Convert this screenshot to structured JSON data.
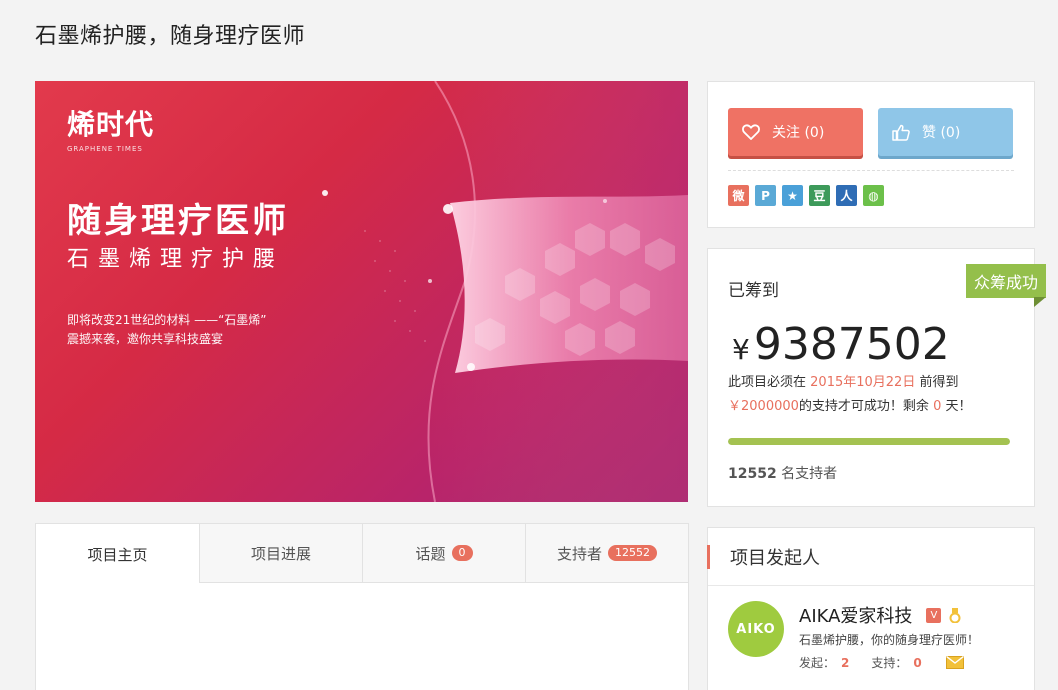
{
  "page": {
    "title": "石墨烯护腰，随身理疗医师"
  },
  "hero": {
    "logo": "烯时代",
    "logo_sub": "GRAPHENE TIMES",
    "headline": "随身理疗医师",
    "subhead": "石墨烯理疗护腰",
    "desc_line1": "即将改变21世纪的材料 ——“石墨烯”",
    "desc_line2": "震撼来袭，邀你共享科技盛宴"
  },
  "actions": {
    "follow_label": "关注 (0)",
    "like_label": "赞 (0)",
    "share_icons": [
      {
        "name": "weibo",
        "glyph": "微",
        "color": "#e8705e"
      },
      {
        "name": "tencent-weibo",
        "glyph": "P",
        "color": "#5aa9d6"
      },
      {
        "name": "qzone",
        "glyph": "★",
        "color": "#4aa0d8"
      },
      {
        "name": "douban",
        "glyph": "豆",
        "color": "#3d9a5a"
      },
      {
        "name": "renren",
        "glyph": "人",
        "color": "#2f6db5"
      },
      {
        "name": "wechat",
        "glyph": "◍",
        "color": "#6cc04a"
      }
    ]
  },
  "funding": {
    "label": "已筹到",
    "status": "众筹成功",
    "currency": "¥",
    "amount": "9387502",
    "note_pre": "此项目必须在",
    "deadline": "2015年10月22日",
    "note_mid": "前得到",
    "goal": "￥2000000",
    "note_post": "的支持才可成功！剩余",
    "days_left": "0",
    "note_end": "天！",
    "progress_fraction": 1.0,
    "supporters_count": "12552",
    "supporters_label": "名支持者",
    "accent": "#e8705e",
    "success_color": "#94bf4b"
  },
  "tabs": [
    {
      "label": "项目主页",
      "count": null
    },
    {
      "label": "项目进展",
      "count": null
    },
    {
      "label": "话题",
      "count": "0"
    },
    {
      "label": "支持者",
      "count": "12552"
    }
  ],
  "founder": {
    "heading": "项目发起人",
    "avatar_text": "AIKO",
    "name": "AIKA爱家科技",
    "verified_badge": "V",
    "desc": "石墨烯护腰，你的随身理疗医师！",
    "launched_label": "发起：",
    "launched_count": "2",
    "supported_label": "支持：",
    "supported_count": "0"
  }
}
